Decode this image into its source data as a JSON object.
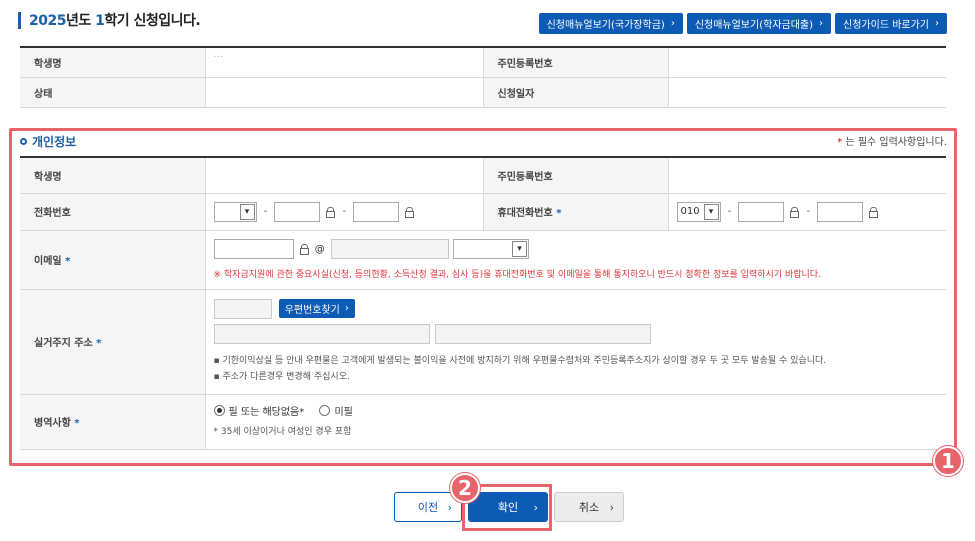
{
  "header": {
    "title_year": "2025",
    "title_mid": "년도 ",
    "title_term": "1",
    "title_rest": "학기 신청입니다."
  },
  "top_buttons": [
    {
      "label": "신청매뉴얼보기(국가장학금)"
    },
    {
      "label": "신청매뉴얼보기(학자금대출)"
    },
    {
      "label": "신청가이드 바로가기"
    }
  ],
  "student_summary": {
    "name_label": "학생명",
    "name_value": "···",
    "rrn_label": "주민등록번호",
    "status_label": "상태",
    "date_label": "신청일자"
  },
  "personal": {
    "section_title": "개인정보",
    "required_note": "는 필수 입력사항입니다.",
    "required_star": "*",
    "name_label": "학생명",
    "rrn_label": "주민등록번호",
    "phone_label": "전화번호",
    "mobile_label": "휴대전화번호",
    "mobile_prefix": "010",
    "email_label": "이메일",
    "email_warning": "※ 학자금지원에 관한 중요사실(신청, 등의현황, 소득산정 결과, 심사 등)을 휴대전화번호 및 이메일을 통해 통지하오니 반드시 정확한 정보를 입력하시기 바랍니다.",
    "address_label": "실거주지 주소",
    "zip_button": "우편번호찾기",
    "address_notes": [
      "기한이익상실 등 안내 우편물은 고객에게 발생되는 불이익을 사전에 방지하기 위해 우편물수령처와 주민등록주소지가 상이할 경우 두 곳 모두 발송될 수 있습니다.",
      "주소가 다른경우 변경해 주십시오."
    ],
    "military_label": "병역사항",
    "military_options": [
      "필 또는 해당없음*",
      "미필"
    ],
    "military_note": "* 35세 이상이거나 여성인 경우 포함"
  },
  "annotations": {
    "badge1": "1",
    "badge2": "2"
  },
  "footer_buttons": {
    "prev": "이전",
    "ok": "확인",
    "cancel": "취소"
  },
  "colors": {
    "accent": "#0d5bb5",
    "highlight": "#e8646b",
    "warning": "#e0353b"
  }
}
